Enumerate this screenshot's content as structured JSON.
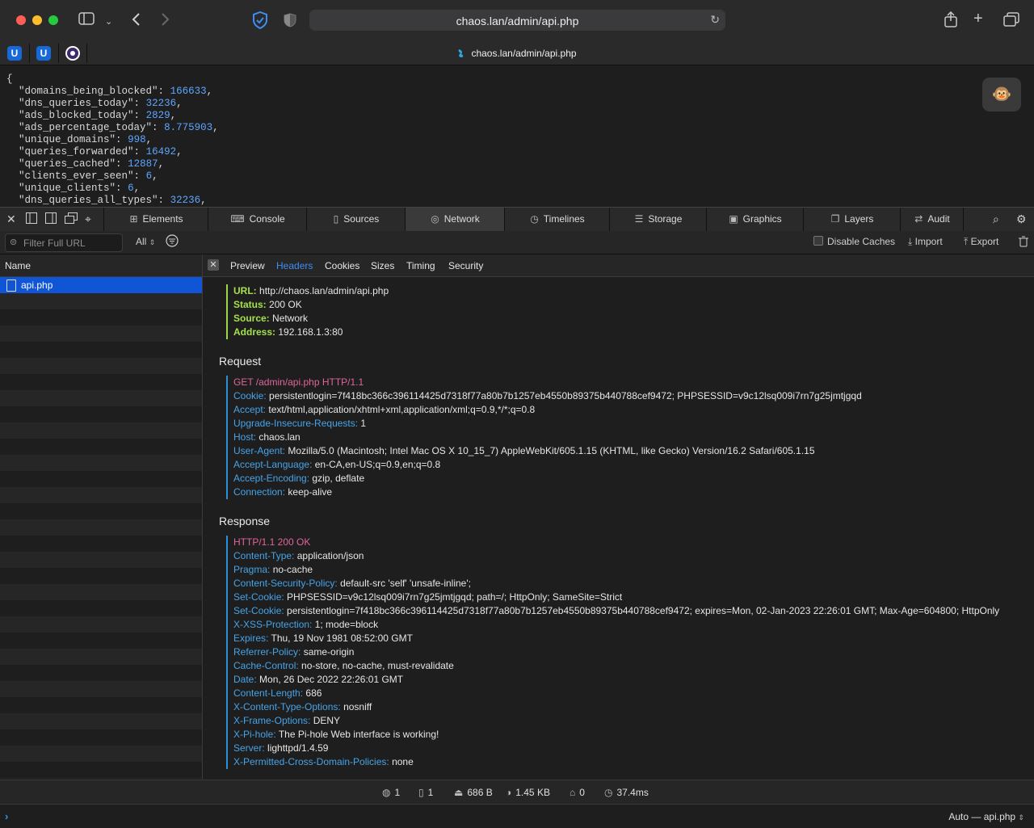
{
  "browser": {
    "address": "chaos.lan/admin/api.php",
    "tab_title": "chaos.lan/admin/api.php",
    "favicons": [
      "U",
      "U",
      ""
    ]
  },
  "json_lines": [
    {
      "key": "\"domains_being_blocked\"",
      "value": "166633"
    },
    {
      "key": "\"dns_queries_today\"",
      "value": "32236"
    },
    {
      "key": "\"ads_blocked_today\"",
      "value": "2829"
    },
    {
      "key": "\"ads_percentage_today\"",
      "value": "8.775903"
    },
    {
      "key": "\"unique_domains\"",
      "value": "998"
    },
    {
      "key": "\"queries_forwarded\"",
      "value": "16492"
    },
    {
      "key": "\"queries_cached\"",
      "value": "12887"
    },
    {
      "key": "\"clients_ever_seen\"",
      "value": "6"
    },
    {
      "key": "\"unique_clients\"",
      "value": "6"
    },
    {
      "key": "\"dns_queries_all_types\"",
      "value": "32236"
    }
  ],
  "json_open": "{",
  "devtools": {
    "tabs": [
      {
        "label": "Elements",
        "icon": "elements-icon",
        "glyph": "⊞"
      },
      {
        "label": "Console",
        "icon": "console-icon",
        "glyph": "⌨"
      },
      {
        "label": "Sources",
        "icon": "sources-icon",
        "glyph": "▯"
      },
      {
        "label": "Network",
        "icon": "network-icon",
        "glyph": "◎"
      },
      {
        "label": "Timelines",
        "icon": "timelines-icon",
        "glyph": "◷"
      },
      {
        "label": "Storage",
        "icon": "storage-icon",
        "glyph": "☰"
      },
      {
        "label": "Graphics",
        "icon": "graphics-icon",
        "glyph": "▣"
      },
      {
        "label": "Layers",
        "icon": "layers-icon",
        "glyph": "❐"
      },
      {
        "label": "Audit",
        "icon": "audit-icon",
        "glyph": "⇄"
      }
    ],
    "selected_tab": "Network",
    "filter_placeholder": "Filter Full URL",
    "type_filter": "All",
    "disable_caches": "Disable Caches",
    "import": "Import",
    "export": "Export",
    "name_header": "Name",
    "selected_resource": "api.php",
    "detail_tabs": [
      "Preview",
      "Headers",
      "Cookies",
      "Sizes",
      "Timing",
      "Security"
    ],
    "selected_detail_tab": "Headers"
  },
  "summary": [
    {
      "k": "URL:",
      "v": "http://chaos.lan/admin/api.php"
    },
    {
      "k": "Status:",
      "v": "200 OK"
    },
    {
      "k": "Source:",
      "v": "Network"
    },
    {
      "k": "Address:",
      "v": "192.168.1.3:80"
    }
  ],
  "request_title": "Request",
  "request_line": "GET /admin/api.php HTTP/1.1",
  "request_headers": [
    {
      "k": "Cookie:",
      "v": "persistentlogin=7f418bc366c396114425d7318f77a80b7b1257eb4550b89375b440788cef9472; PHPSESSID=v9c12lsq009i7rn7g25jmtjgqd"
    },
    {
      "k": "Accept:",
      "v": "text/html,application/xhtml+xml,application/xml;q=0.9,*/*;q=0.8"
    },
    {
      "k": "Upgrade-Insecure-Requests:",
      "v": "1"
    },
    {
      "k": "Host:",
      "v": "chaos.lan"
    },
    {
      "k": "User-Agent:",
      "v": "Mozilla/5.0 (Macintosh; Intel Mac OS X 10_15_7) AppleWebKit/605.1.15 (KHTML, like Gecko) Version/16.2 Safari/605.1.15"
    },
    {
      "k": "Accept-Language:",
      "v": "en-CA,en-US;q=0.9,en;q=0.8"
    },
    {
      "k": "Accept-Encoding:",
      "v": "gzip, deflate"
    },
    {
      "k": "Connection:",
      "v": "keep-alive"
    }
  ],
  "response_title": "Response",
  "response_line": "HTTP/1.1 200 OK",
  "response_headers": [
    {
      "k": "Content-Type:",
      "v": "application/json"
    },
    {
      "k": "Pragma:",
      "v": "no-cache"
    },
    {
      "k": "Content-Security-Policy:",
      "v": "default-src 'self' 'unsafe-inline';"
    },
    {
      "k": "Set-Cookie:",
      "v": "PHPSESSID=v9c12lsq009i7rn7g25jmtjgqd; path=/; HttpOnly; SameSite=Strict"
    },
    {
      "k": "Set-Cookie:",
      "v": "persistentlogin=7f418bc366c396114425d7318f77a80b7b1257eb4550b89375b440788cef9472; expires=Mon, 02-Jan-2023 22:26:01 GMT; Max-Age=604800; HttpOnly"
    },
    {
      "k": "X-XSS-Protection:",
      "v": "1; mode=block"
    },
    {
      "k": "Expires:",
      "v": "Thu, 19 Nov 1981 08:52:00 GMT"
    },
    {
      "k": "Referrer-Policy:",
      "v": "same-origin"
    },
    {
      "k": "Cache-Control:",
      "v": "no-store, no-cache, must-revalidate"
    },
    {
      "k": "Date:",
      "v": "Mon, 26 Dec 2022 22:26:01 GMT"
    },
    {
      "k": "Content-Length:",
      "v": "686"
    },
    {
      "k": "X-Content-Type-Options:",
      "v": "nosniff"
    },
    {
      "k": "X-Frame-Options:",
      "v": "DENY"
    },
    {
      "k": "X-Pi-hole:",
      "v": "The Pi-hole Web interface is working!"
    },
    {
      "k": "Server:",
      "v": "lighttpd/1.4.59"
    },
    {
      "k": "X-Permitted-Cross-Domain-Policies:",
      "v": "none"
    }
  ],
  "status": {
    "domains": "1",
    "resources": "1",
    "transferred": "686 B",
    "size": "1.45 KB",
    "redirects": "0",
    "time": "37.4ms"
  },
  "console_context": "Auto — api.php"
}
